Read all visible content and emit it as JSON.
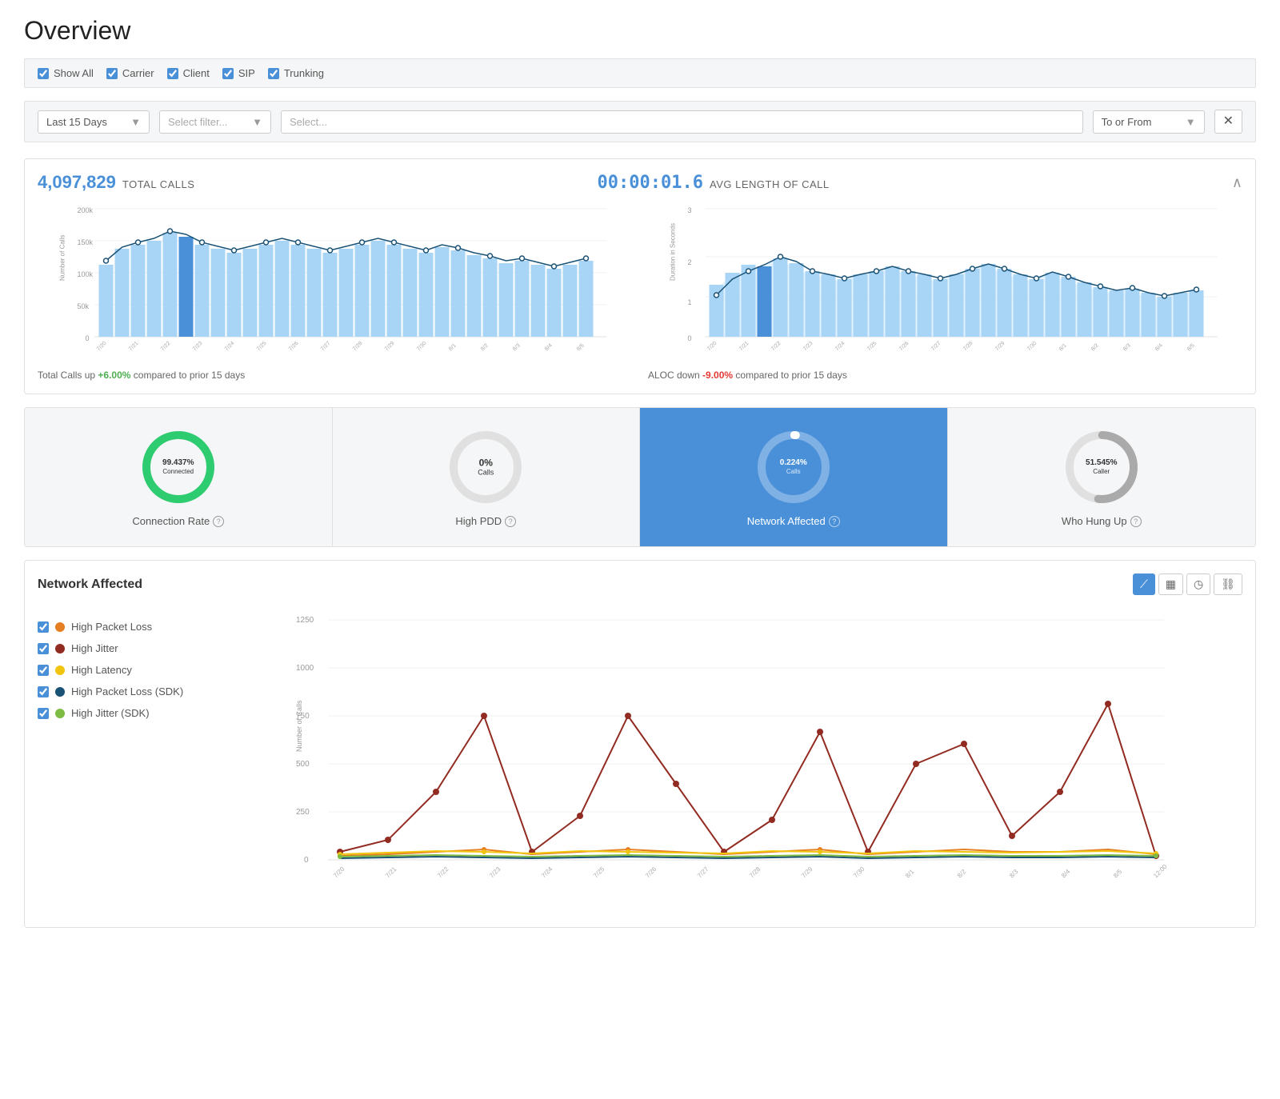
{
  "page": {
    "title": "Overview"
  },
  "filterbar": {
    "show_all_label": "Show All",
    "carrier_label": "Carrier",
    "client_label": "Client",
    "sip_label": "SIP",
    "trunking_label": "Trunking"
  },
  "dropdowns": {
    "date_range": "Last 15 Days",
    "filter_placeholder": "Select filter...",
    "select_placeholder": "Select...",
    "direction_label": "To or From"
  },
  "total_calls": {
    "number": "4,097,829",
    "label": "Total Calls",
    "change_text": "Total Calls up",
    "change_value": "+6.00%",
    "change_direction": "up",
    "compare_text": "compared to prior 15 days"
  },
  "avg_length": {
    "number": "00:00:01.6",
    "label": "Avg Length of Call",
    "change_text": "ALOC down",
    "change_value": "-9.00%",
    "change_direction": "down",
    "compare_text": "compared to prior 15 days"
  },
  "stats": [
    {
      "id": "connection-rate",
      "value": "99.437%",
      "sublabel": "Connected",
      "label": "Connection Rate",
      "active": false,
      "color": "#2ecc71",
      "track": "#e0e0e0"
    },
    {
      "id": "high-pdd",
      "value": "0%",
      "sublabel": "Calls",
      "label": "High PDD",
      "active": false,
      "color": "#ccc",
      "track": "#e0e0e0"
    },
    {
      "id": "network-affected",
      "value": "0.224%",
      "sublabel": "Calls",
      "label": "Network Affected",
      "active": true,
      "color": "#fff",
      "track": "rgba(255,255,255,0.3)"
    },
    {
      "id": "who-hung-up",
      "value": "51.545%",
      "sublabel": "Caller",
      "label": "Who Hung Up",
      "active": false,
      "color": "#aaa",
      "track": "#e0e0e0"
    }
  ],
  "network_affected": {
    "title": "Network Affected",
    "tools": [
      "line-icon",
      "bar-icon",
      "clock-icon",
      "link-icon"
    ],
    "legend": [
      {
        "id": "high-packet-loss",
        "label": "High Packet Loss",
        "color": "#e67e22",
        "checked": true
      },
      {
        "id": "high-jitter",
        "label": "High Jitter",
        "color": "#922b21",
        "checked": true
      },
      {
        "id": "high-latency",
        "label": "High Latency",
        "color": "#f1c40f",
        "checked": true
      },
      {
        "id": "high-packet-loss-sdk",
        "label": "High Packet Loss (SDK)",
        "color": "#1a5276",
        "checked": true
      },
      {
        "id": "high-jitter-sdk",
        "label": "High Jitter (SDK)",
        "color": "#7dbb43",
        "checked": true
      }
    ],
    "y_axis_labels": [
      "1250",
      "1000",
      "750",
      "500",
      "250",
      "0"
    ],
    "y_axis_title": "Number of Calls"
  },
  "bar_chart_y_labels": [
    "200k",
    "150k",
    "100k",
    "50k",
    "0"
  ],
  "bar_chart2_y_labels": [
    "3",
    "2",
    "1",
    "0"
  ],
  "colors": {
    "primary_blue": "#4a90d9",
    "light_blue": "#a8d4f5",
    "green": "#2ecc71",
    "red": "#e53935",
    "orange": "#e67e22",
    "dark_red": "#922b21",
    "yellow": "#f1c40f",
    "navy": "#1a5276",
    "lime": "#7dbb43"
  }
}
